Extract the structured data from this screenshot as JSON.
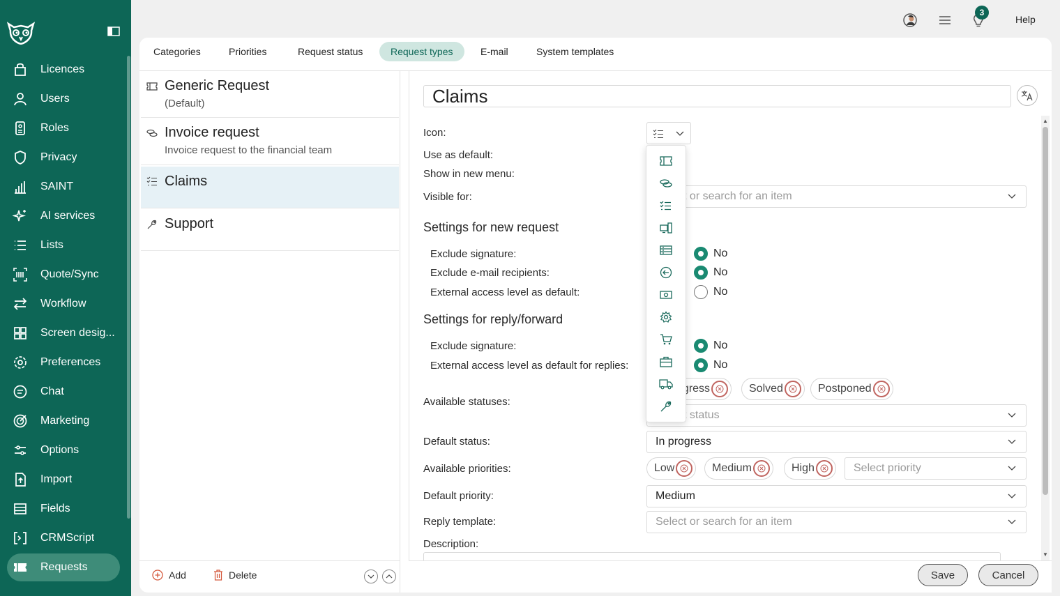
{
  "sidebar": {
    "items": [
      {
        "label": "Licences",
        "icon": "bag-icon"
      },
      {
        "label": "Users",
        "icon": "user-icon"
      },
      {
        "label": "Roles",
        "icon": "roles-icon"
      },
      {
        "label": "Privacy",
        "icon": "shield-icon"
      },
      {
        "label": "SAINT",
        "icon": "bar-chart-icon"
      },
      {
        "label": "AI services",
        "icon": "sparkle-icon"
      },
      {
        "label": "Lists",
        "icon": "list-icon"
      },
      {
        "label": "Quote/Sync",
        "icon": "barcode-icon"
      },
      {
        "label": "Workflow",
        "icon": "arrows-icon"
      },
      {
        "label": "Screen desig...",
        "icon": "grid-icon"
      },
      {
        "label": "Preferences",
        "icon": "gear-icon"
      },
      {
        "label": "Chat",
        "icon": "chat-icon"
      },
      {
        "label": "Marketing",
        "icon": "target-icon"
      },
      {
        "label": "Options",
        "icon": "sliders-icon"
      },
      {
        "label": "Import",
        "icon": "import-icon"
      },
      {
        "label": "Fields",
        "icon": "fields-icon"
      },
      {
        "label": "CRMScript",
        "icon": "script-icon"
      },
      {
        "label": "Requests",
        "icon": "ticket-icon"
      }
    ],
    "active": "Requests"
  },
  "topbar": {
    "notifications_count": "3",
    "help_label": "Help"
  },
  "tabs": [
    "Categories",
    "Priorities",
    "Request status",
    "Request types",
    "E-mail",
    "System templates"
  ],
  "active_tab": "Request types",
  "request_types": [
    {
      "title": "Generic Request",
      "subtitle": "(Default)",
      "icon": "ticket-icon"
    },
    {
      "title": "Invoice request",
      "subtitle": "Invoice request to the financial team",
      "icon": "coins-icon"
    },
    {
      "title": "Claims",
      "subtitle": "",
      "icon": "checklist-icon"
    },
    {
      "title": "Support",
      "subtitle": "",
      "icon": "wrench-icon"
    }
  ],
  "left_footer": {
    "add_label": "Add",
    "delete_label": "Delete"
  },
  "form": {
    "name": "Claims",
    "labels": {
      "icon": "Icon:",
      "use_as_default": "Use as default:",
      "show_in_new_menu": "Show in new menu:",
      "visible_for": "Visible for:",
      "available_statuses": "Available statuses:",
      "default_status": "Default status:",
      "available_priorities": "Available priorities:",
      "default_priority": "Default priority:",
      "reply_template": "Reply template:",
      "description": "Description:"
    },
    "visible_for_placeholder": "Select or search for an item",
    "section_new_request": "Settings for new request",
    "new_request": [
      {
        "label": "Exclude signature:",
        "value": "No",
        "checked": true
      },
      {
        "label": "Exclude e-mail recipients:",
        "value": "No",
        "checked": true
      },
      {
        "label": "External access level as default:",
        "value": "No",
        "checked": false
      }
    ],
    "section_reply": "Settings for reply/forward",
    "reply": [
      {
        "label": "Exclude signature:",
        "value": "No",
        "checked": true
      },
      {
        "label": "External access level as default for replies:",
        "value": "No",
        "checked": true
      }
    ],
    "statuses": [
      "In progress",
      "Solved",
      "Postponed"
    ],
    "status_placeholder": "Select status",
    "default_status": "In progress",
    "priorities": [
      "Low",
      "Medium",
      "High"
    ],
    "priority_placeholder": "Select priority",
    "default_priority": "Medium",
    "reply_template_placeholder": "Select or search for an item"
  },
  "icon_options": [
    "ticket-icon",
    "coins-icon",
    "checklist-icon",
    "devices-icon",
    "server-icon",
    "arrow-left-circle-icon",
    "money-icon",
    "gear-icon",
    "cart-icon",
    "briefcase-icon",
    "truck-icon",
    "wrench-icon"
  ],
  "buttons": {
    "save": "Save",
    "cancel": "Cancel"
  },
  "colors": {
    "sidebar": "#0d6656",
    "accent": "#1a8a72",
    "selected_row": "#e6f1f6",
    "remove_chip": "#c0645f"
  }
}
